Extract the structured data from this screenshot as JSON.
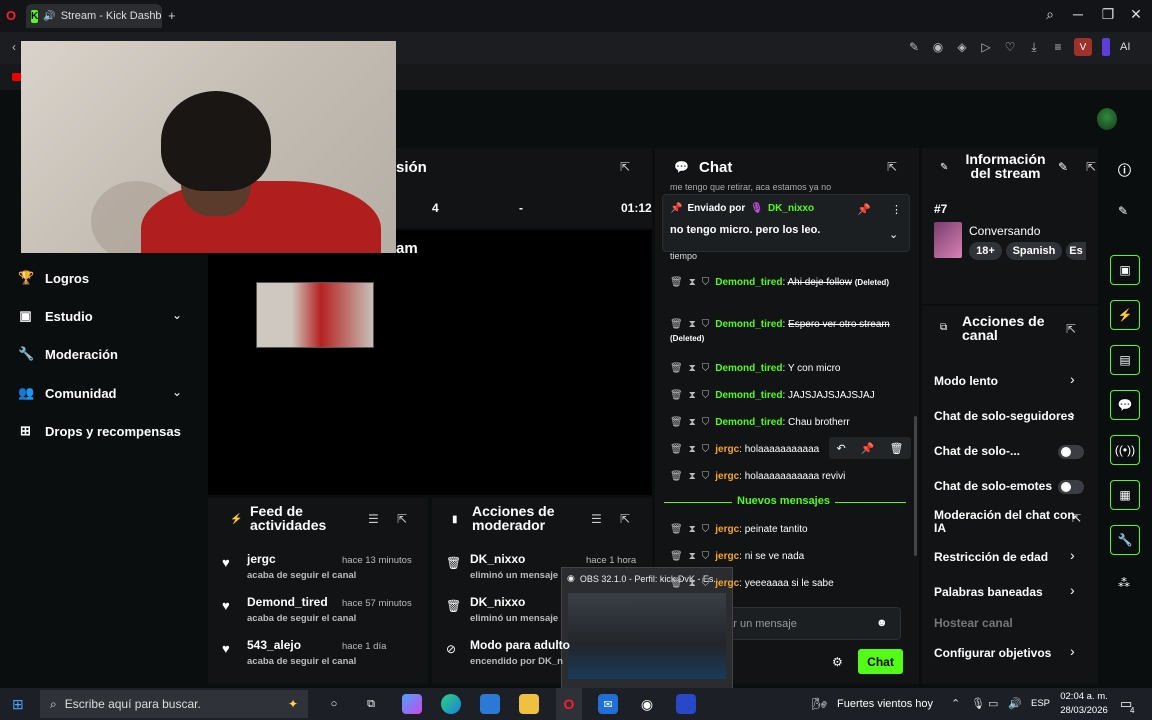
{
  "browser": {
    "tab_title": "Stream - Kick Dashboa",
    "ai_label": "AI",
    "profile_letter": "V"
  },
  "sidebar": {
    "items": [
      {
        "label": "Logros",
        "icon": "trophy-icon"
      },
      {
        "label": "Estudio",
        "icon": "video-icon"
      },
      {
        "label": "Moderación",
        "icon": "wrench-icon"
      },
      {
        "label": "Comunidad",
        "icon": "users-icon"
      },
      {
        "label": "Drops y recompensas",
        "icon": "gift-icon"
      }
    ]
  },
  "session_panel": {
    "title_partial": "sión",
    "stats": [
      "4",
      "-",
      "01:12"
    ],
    "preview_title_partial": "am"
  },
  "chat": {
    "title": "Chat",
    "truncated_top": "me tengo que retirar, aca estamos ya no",
    "pinned": {
      "prefix": "Enviado por",
      "user": "DK_nixxo",
      "message": "no tengo micro. pero los leo."
    },
    "tiempo": "tiempo",
    "messages": [
      {
        "user": "Demond_tired",
        "text": "Ahi deje follow",
        "deleted": true,
        "color": "g"
      },
      {
        "user": "Demond_tired",
        "text": "Espero ver otro stream",
        "deleted": true,
        "color": "g"
      },
      {
        "user": "Demond_tired",
        "text": "Y con micro",
        "deleted": false,
        "color": "g"
      },
      {
        "user": "Demond_tired",
        "text": "JAJSJAJSJAJSJAJ",
        "deleted": false,
        "color": "g"
      },
      {
        "user": "Demond_tired",
        "text": "Chau brotherr",
        "deleted": false,
        "color": "g"
      },
      {
        "user": "jergc",
        "text": "holaaaaaaaaaaa",
        "deleted": false,
        "color": "o"
      },
      {
        "user": "jergc",
        "text": "holaaaaaaaaaaa revivi",
        "deleted": false,
        "color": "o"
      }
    ],
    "deleted_label": "(Deleted)",
    "new_messages": "Nuevos mensajes",
    "new": [
      {
        "user": "jergc",
        "text": "peinate tantito"
      },
      {
        "user": "jergc",
        "text": "ni se ve nada"
      },
      {
        "user": "jergc",
        "text": "yeeeaaaa si le sabe"
      }
    ],
    "input_placeholder": "...viar un mensaje",
    "send": "Chat"
  },
  "info": {
    "title": "Información del stream",
    "number": "#7",
    "category": "Conversando",
    "tags": [
      "18+",
      "Spanish",
      "Es"
    ]
  },
  "channel_actions": {
    "title": "Acciones de canal",
    "items": [
      {
        "label": "Modo lento",
        "control": "arrow"
      },
      {
        "label": "Chat de solo-seguidores",
        "control": "arrow"
      },
      {
        "label": "Chat de solo-...",
        "control": "toggle"
      },
      {
        "label": "Chat de solo-emotes",
        "control": "toggle"
      },
      {
        "label": "Moderación del chat con IA",
        "control": "external"
      },
      {
        "label": "Restricción de edad",
        "control": "arrow"
      },
      {
        "label": "Palabras baneadas",
        "control": "arrow"
      },
      {
        "label": "Hostear canal",
        "control": "none"
      },
      {
        "label": "Configurar objetivos",
        "control": "arrow"
      }
    ]
  },
  "activity": {
    "title": "Feed de actividades",
    "items": [
      {
        "user": "jergc",
        "time": "hace 13 minutos",
        "sub": "acaba de seguir el canal"
      },
      {
        "user": "Demond_tired",
        "time": "hace 57 minutos",
        "sub": "acaba de seguir el canal"
      },
      {
        "user": "543_alejo",
        "time": "hace 1 día",
        "sub": "acaba de seguir el canal"
      }
    ]
  },
  "modactions": {
    "title": "Acciones de moderador",
    "items": [
      {
        "user": "DK_nixxo",
        "time": "hace 1 hora",
        "sub": "eliminó un mensaje"
      },
      {
        "user": "DK_nixxo",
        "time": "",
        "sub": "eliminó un mensaje"
      },
      {
        "user": "Modo para adulto",
        "time": "",
        "sub": "encendido por DK_n"
      }
    ]
  },
  "obs": {
    "title": "OBS 32.1.0 - Perfil: kick DvK - Es..."
  },
  "taskbar": {
    "search": "Escribe aquí para buscar.",
    "weather": "Fuertes vientos hoy",
    "lang": "ESP",
    "time": "02:04 a. m.",
    "date": "28/03/2026",
    "notif": "4"
  },
  "colors": {
    "accent": "#53fc18",
    "user_orange": "#f5a623",
    "panel": "#111315"
  }
}
